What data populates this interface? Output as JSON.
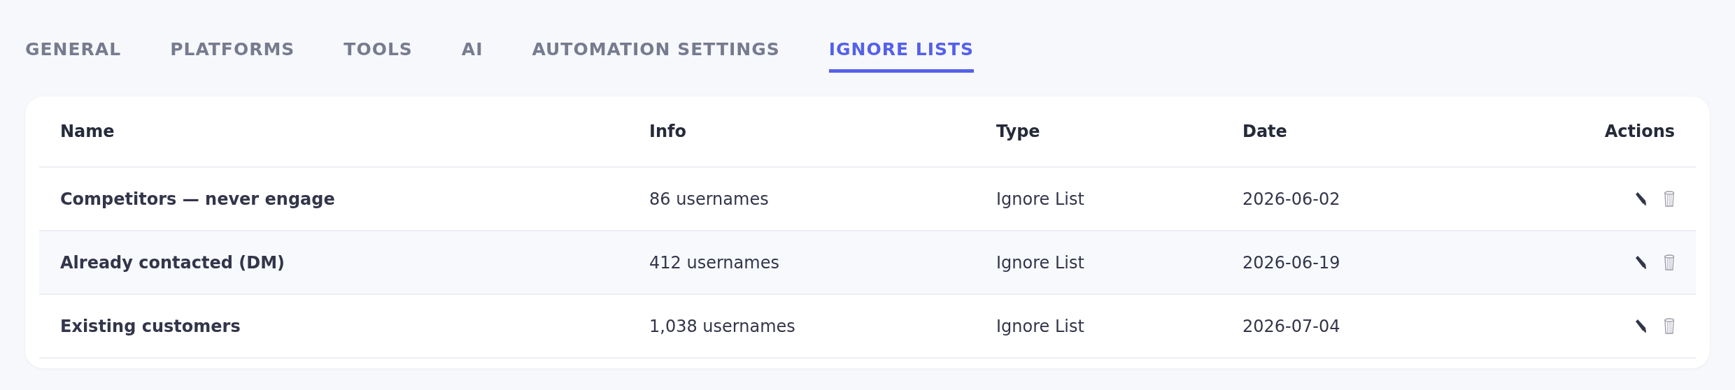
{
  "tabs": [
    {
      "label": "GENERAL",
      "selected": false
    },
    {
      "label": "PLATFORMS",
      "selected": false
    },
    {
      "label": "TOOLS",
      "selected": false
    },
    {
      "label": "AI",
      "selected": false
    },
    {
      "label": "AUTOMATION SETTINGS",
      "selected": false
    },
    {
      "label": "IGNORE LISTS",
      "selected": true
    }
  ],
  "table": {
    "columns": [
      "Name",
      "Info",
      "Type",
      "Date",
      "Actions"
    ],
    "rows": [
      {
        "name": "Competitors — never engage",
        "info": "86 usernames",
        "type": "Ignore List",
        "date": "2026-06-02"
      },
      {
        "name": "Already contacted (DM)",
        "info": "412 usernames",
        "type": "Ignore List",
        "date": "2026-06-19"
      },
      {
        "name": "Existing customers",
        "info": "1,038 usernames",
        "type": "Ignore List",
        "date": "2026-07-04"
      }
    ]
  }
}
